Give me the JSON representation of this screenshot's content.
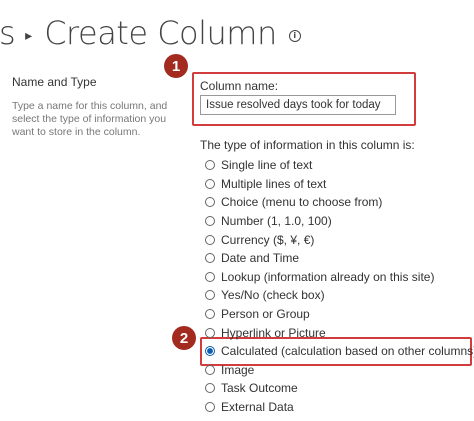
{
  "header": {
    "breadcrumb_prev": "s",
    "separator": "▸",
    "title": "Create Column",
    "info_glyph": "i"
  },
  "name_section": {
    "title": "Name and Type",
    "description": "Type a name for this column, and select the type of information you want to store in the column."
  },
  "column_name": {
    "label": "Column name:",
    "value": "Issue resolved days took for today"
  },
  "type_prompt": "The type of information in this column is:",
  "types": [
    {
      "label": "Single line of text",
      "selected": false
    },
    {
      "label": "Multiple lines of text",
      "selected": false
    },
    {
      "label": "Choice (menu to choose from)",
      "selected": false
    },
    {
      "label": "Number (1, 1.0, 100)",
      "selected": false
    },
    {
      "label": "Currency ($, ¥, €)",
      "selected": false
    },
    {
      "label": "Date and Time",
      "selected": false
    },
    {
      "label": "Lookup (information already on this site)",
      "selected": false
    },
    {
      "label": "Yes/No (check box)",
      "selected": false
    },
    {
      "label": "Person or Group",
      "selected": false
    },
    {
      "label": "Hyperlink or Picture",
      "selected": false
    },
    {
      "label": "Calculated (calculation based on other columns)",
      "selected": true
    },
    {
      "label": "Image",
      "selected": false
    },
    {
      "label": "Task Outcome",
      "selected": false
    },
    {
      "label": "External Data",
      "selected": false
    }
  ],
  "annotations": {
    "marker1": "1",
    "marker2": "2"
  },
  "colors": {
    "highlight": "#d23c3c",
    "marker": "#a32a1f",
    "radio_selected": "#0a5fb3"
  }
}
